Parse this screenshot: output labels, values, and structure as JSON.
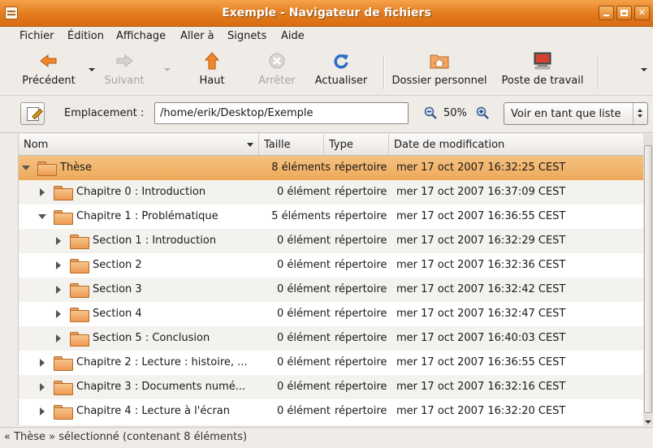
{
  "window": {
    "title": "Exemple - Navigateur de fichiers"
  },
  "menu": [
    "Fichier",
    "Édition",
    "Affichage",
    "Aller à",
    "Signets",
    "Aide"
  ],
  "toolbar": {
    "back": "Précédent",
    "forward": "Suivant",
    "up": "Haut",
    "stop": "Arrêter",
    "reload": "Actualiser",
    "home": "Dossier personnel",
    "computer": "Poste de travail"
  },
  "location": {
    "label": "Emplacement :",
    "path": "/home/erik/Desktop/Exemple",
    "zoom": "50%",
    "view_mode": "Voir en tant que liste"
  },
  "columns": {
    "name": "Nom",
    "size": "Taille",
    "type": "Type",
    "date": "Date de modification"
  },
  "rows": [
    {
      "name": "Thèse",
      "size": "8 éléments",
      "type": "répertoire",
      "date": "mer 17 oct 2007 16:32:25 CEST",
      "expanded": true,
      "selected": true
    },
    {
      "name": "Chapitre 0 : Introduction",
      "size": "0 élément",
      "type": "répertoire",
      "date": "mer 17 oct 2007 16:37:09 CEST",
      "expanded": false
    },
    {
      "name": "Chapitre 1 : Problématique",
      "size": "5 éléments",
      "type": "répertoire",
      "date": "mer 17 oct 2007 16:36:55 CEST",
      "expanded": true
    },
    {
      "name": "Section 1 : Introduction",
      "size": "0 élément",
      "type": "répertoire",
      "date": "mer 17 oct 2007 16:32:29 CEST",
      "expanded": false
    },
    {
      "name": "Section 2",
      "size": "0 élément",
      "type": "répertoire",
      "date": "mer 17 oct 2007 16:32:36 CEST",
      "expanded": false
    },
    {
      "name": "Section 3",
      "size": "0 élément",
      "type": "répertoire",
      "date": "mer 17 oct 2007 16:32:42 CEST",
      "expanded": false
    },
    {
      "name": "Section 4",
      "size": "0 élément",
      "type": "répertoire",
      "date": "mer 17 oct 2007 16:32:47 CEST",
      "expanded": false
    },
    {
      "name": "Section 5 : Conclusion",
      "size": "0 élément",
      "type": "répertoire",
      "date": "mer 17 oct 2007 16:40:03 CEST",
      "expanded": false
    },
    {
      "name": "Chapitre 2 : Lecture : histoire, ...",
      "size": "0 élément",
      "type": "répertoire",
      "date": "mer 17 oct 2007 16:36:55 CEST",
      "expanded": false
    },
    {
      "name": "Chapitre 3 : Documents numé...",
      "size": "0 élément",
      "type": "répertoire",
      "date": "mer 17 oct 2007 16:32:16 CEST",
      "expanded": false
    },
    {
      "name": "Chapitre 4 : Lecture à l'écran",
      "size": "0 élément",
      "type": "répertoire",
      "date": "mer 17 oct 2007 16:32:20 CEST",
      "expanded": false
    }
  ],
  "status": "« Thèse » sélectionné (contenant 8 éléments)",
  "colors": {
    "titlebar": "#e27a1c",
    "selection": "#eea95a",
    "folder": "#ec9a52"
  }
}
